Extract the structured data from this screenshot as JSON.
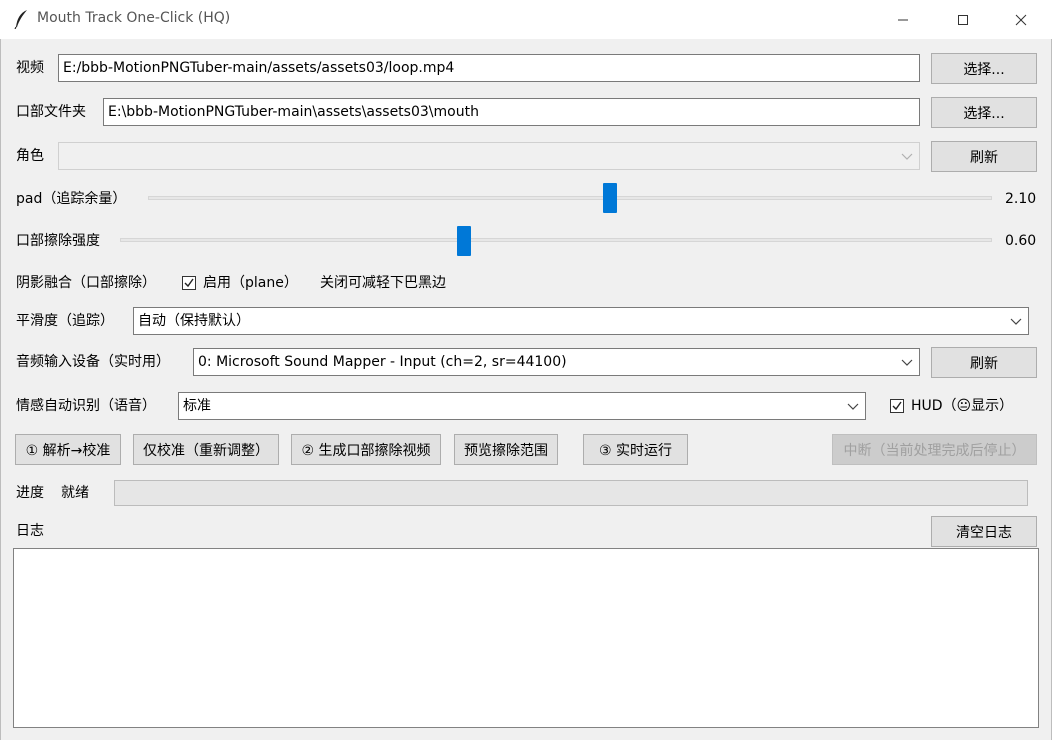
{
  "window": {
    "title": "Mouth Track One-Click (HQ)"
  },
  "video": {
    "label": "视频",
    "value": "E:/bbb-MotionPNGTuber-main/assets/assets03/loop.mp4",
    "browse_label": "选择..."
  },
  "mouth_folder": {
    "label": "口部文件夹",
    "value": "E:\\bbb-MotionPNGTuber-main\\assets\\assets03\\mouth",
    "browse_label": "选择..."
  },
  "character": {
    "label": "角色",
    "value": "",
    "refresh_label": "刷新"
  },
  "pad": {
    "label": "pad（追踪余量）",
    "value_text": "2.10",
    "fraction": 0.547
  },
  "erase_strength": {
    "label": "口部擦除强度",
    "value_text": "0.60",
    "fraction": 0.395
  },
  "shadow": {
    "label": "阴影融合（口部擦除）",
    "checkbox_label": "启用（plane）",
    "checked": true,
    "hint": "关闭可减轻下巴黑边"
  },
  "smoothing": {
    "label": "平滑度（追踪）",
    "value": "自动（保持默认）"
  },
  "audio": {
    "label": "音频输入设备（实时用）",
    "value": "0: Microsoft Sound Mapper - Input  (ch=2, sr=44100)",
    "refresh_label": "刷新"
  },
  "emotion": {
    "label": "情感自动识别（语音）",
    "value": "标准",
    "hud_label": "HUD（😐显示）",
    "hud_checked": true
  },
  "actions": {
    "analyze_label": "① 解析→校准",
    "calibrate_label": "仅校准（重新调整）",
    "generate_label": "② 生成口部擦除视频",
    "preview_label": "预览擦除范围",
    "realtime_label": "③ 实时运行",
    "stop_label": "中断（当前处理完成后停止）"
  },
  "progress": {
    "label": "进度",
    "status": "就绪",
    "percent": 0
  },
  "log": {
    "label": "日志",
    "clear_label": "清空日志",
    "content": ""
  },
  "colors": {
    "accent": "#0078d7",
    "window_bg": "#f0f0f0",
    "titlebar_bg": "#ffffff"
  },
  "icons": {
    "app": "feather-icon",
    "minimize": "minimize-icon",
    "maximize": "maximize-icon",
    "close": "close-icon",
    "dropdown": "chevron-down-icon",
    "checkmark": "checkmark-icon"
  }
}
